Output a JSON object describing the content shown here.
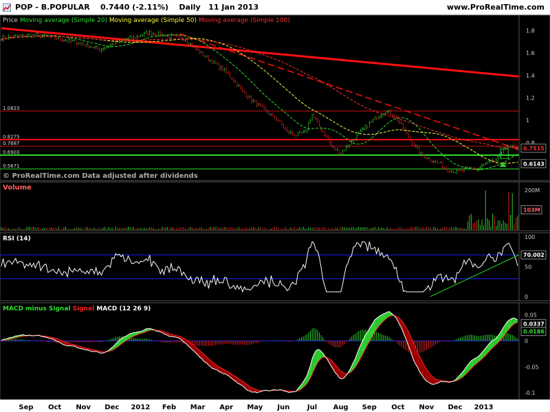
{
  "header": {
    "instrument": "POP - B.POPULAR",
    "price": "0.7440",
    "change": "(-2.11%)",
    "period": "Daily",
    "date": "11 Jan 2013",
    "site": "www.ProRealTime.com"
  },
  "colors": {
    "bull": "#30d030",
    "bear": "#e02020",
    "ma20": "#30e030",
    "ma50": "#ffff40",
    "ma100": "#ff3030",
    "signal": "#ff2020",
    "macd": "#ffffff",
    "accent": "#2020ff",
    "trend": "#20c020"
  },
  "chart_data": [
    {
      "type": "candlestick",
      "panel": "price",
      "legend": [
        {
          "label": "Price",
          "color": "#d0d0d0"
        },
        {
          "label": "Moving average (Simple 20)",
          "color": "#30e030"
        },
        {
          "label": "Moving average (Simple 50)",
          "color": "#ffff40"
        },
        {
          "label": "Moving average (Simple 100)",
          "color": "#ff3030"
        }
      ],
      "watermark": "© ProRealTime.com  Data adjusted after dividends",
      "yticks": [
        "1.8",
        "1.6",
        "1.4",
        "1.2",
        "1",
        "0.8",
        "0.6"
      ],
      "ylim": [
        0.5,
        1.9
      ],
      "xticks": [
        "Sep",
        "Oct",
        "Nov",
        "Dec",
        "2012",
        "Feb",
        "Mar",
        "Apr",
        "May",
        "Jun",
        "Jul",
        "Aug",
        "Sep",
        "Oct",
        "Nov",
        "Dec",
        "2013"
      ],
      "series_close": [
        [
          0,
          1.73
        ],
        [
          10,
          1.75
        ],
        [
          20,
          1.76
        ],
        [
          30,
          1.73
        ],
        [
          40,
          1.7
        ],
        [
          50,
          1.66
        ],
        [
          55,
          1.63
        ],
        [
          60,
          1.66
        ],
        [
          65,
          1.7
        ],
        [
          70,
          1.72
        ],
        [
          75,
          1.74
        ],
        [
          82,
          1.78
        ],
        [
          90,
          1.76
        ],
        [
          98,
          1.74
        ],
        [
          103,
          1.72
        ],
        [
          110,
          1.62
        ],
        [
          115,
          1.56
        ],
        [
          120,
          1.5
        ],
        [
          125,
          1.44
        ],
        [
          130,
          1.36
        ],
        [
          135,
          1.26
        ],
        [
          140,
          1.18
        ],
        [
          145,
          1.12
        ],
        [
          150,
          1.06
        ],
        [
          155,
          1.0
        ],
        [
          160,
          0.9
        ],
        [
          165,
          0.87
        ],
        [
          170,
          0.89
        ],
        [
          174,
          1.05
        ],
        [
          178,
          0.95
        ],
        [
          182,
          0.85
        ],
        [
          186,
          0.75
        ],
        [
          190,
          0.71
        ],
        [
          195,
          0.79
        ],
        [
          200,
          0.88
        ],
        [
          203,
          0.92
        ],
        [
          206,
          0.97
        ],
        [
          210,
          1.03
        ],
        [
          215,
          1.08
        ],
        [
          220,
          1.05
        ],
        [
          225,
          0.93
        ],
        [
          230,
          0.8
        ],
        [
          235,
          0.7
        ],
        [
          240,
          0.65
        ],
        [
          245,
          0.62
        ],
        [
          250,
          0.56
        ],
        [
          255,
          0.54
        ],
        [
          260,
          0.56
        ],
        [
          263,
          0.58
        ],
        [
          266,
          0.56
        ],
        [
          269,
          0.59
        ],
        [
          272,
          0.62
        ],
        [
          276,
          0.63
        ],
        [
          279,
          0.68
        ],
        [
          281,
          0.76
        ]
      ],
      "hlines": [
        {
          "value": 1.0823,
          "label": "1.0823",
          "color": "#d01010",
          "width": 1
        },
        {
          "value": 0.8275,
          "label": "0.8275",
          "color": "#ff1010",
          "width": 2
        },
        {
          "value": 0.7687,
          "label": "0.7687",
          "color": "#d01010",
          "width": 1
        },
        {
          "value": 0.6903,
          "label": "0.6903",
          "color": "#30e030",
          "width": 2
        },
        {
          "value": 0.5671,
          "label": "0.5671",
          "color": "#30e030",
          "width": 1
        }
      ],
      "value_tags": [
        {
          "value": 0.7515,
          "label": "0.7515",
          "color": "#ff3030"
        },
        {
          "value": 0.6143,
          "label": "0.6143",
          "color": "#ffffff"
        }
      ],
      "trendlines": [
        {
          "from": [
            0,
            1.82
          ],
          "to": [
            290,
            1.39
          ],
          "color": "#ff1010",
          "width": 3
        },
        {
          "from": [
            100,
            1.77
          ],
          "to": [
            290,
            0.74
          ],
          "color": "#ff1010",
          "width": 1.5,
          "dash": "10,5"
        }
      ]
    },
    {
      "type": "bar",
      "panel": "volume",
      "legend": [
        {
          "label": "Volume",
          "color": "#ff6060"
        }
      ],
      "yticks": [
        "200M"
      ],
      "ylim": [
        0,
        220
      ],
      "value_tag": "103M"
    },
    {
      "type": "line",
      "panel": "rsi",
      "legend": [
        {
          "label": "RSI",
          "color": "#ffffff"
        },
        {
          "label": "(14)",
          "color": "#ffffff"
        }
      ],
      "yticks": [
        "100",
        "50",
        "0"
      ],
      "ylim": [
        0,
        100
      ],
      "bands": [
        70,
        30
      ],
      "value_tag": "70.002",
      "trendline": {
        "from": [
          240,
          0
        ],
        "to": [
          290,
          70
        ]
      }
    },
    {
      "type": "histogram",
      "panel": "macd",
      "legend": [
        {
          "label": "MACD minus Signal",
          "color": "#30e030"
        },
        {
          "label": "Signal",
          "color": "#ff2020"
        },
        {
          "label": "MACD",
          "color": "#ffffff"
        },
        {
          "label": "(12 26 9)",
          "color": "#ffffff"
        }
      ],
      "yticks": [
        "0.05",
        "0",
        "-0.05",
        "-0.1"
      ],
      "ylim": [
        -0.105,
        0.065
      ],
      "value_tags": [
        {
          "label": "0.0337",
          "color": "#ffffff"
        },
        {
          "label": "0.0186",
          "color": "#30e030"
        }
      ]
    }
  ]
}
